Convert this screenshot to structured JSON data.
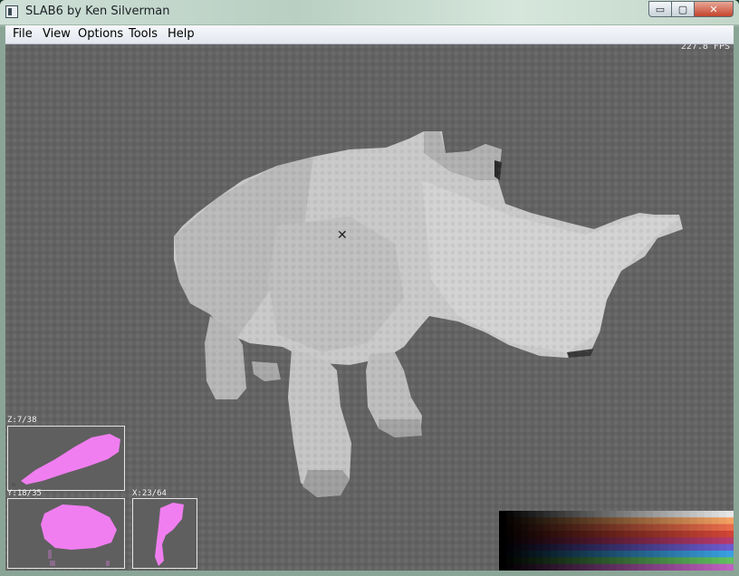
{
  "window": {
    "title": "SLAB6 by Ken Silverman",
    "buttons": {
      "minimize": "▭",
      "maximize": "▢",
      "close": "✕"
    }
  },
  "menu": {
    "items": [
      {
        "label": "File"
      },
      {
        "label": "View"
      },
      {
        "label": "Options"
      },
      {
        "label": "Tools"
      },
      {
        "label": "Help"
      }
    ]
  },
  "viewport": {
    "fps": "227.8 FPS",
    "background": "#636363",
    "cursor_glyph": "✕"
  },
  "slices": {
    "z": {
      "label": "Z:7/38"
    },
    "y": {
      "label": "Y:18/35"
    },
    "x": {
      "label": "X:23/64"
    },
    "fill_color": "#f07ef0"
  },
  "palette": {
    "columns": [
      "#000000",
      "#1c1c1c",
      "#3a3a3a",
      "#555555",
      "#777777",
      "#999999",
      "#bbbbbb",
      "#dddddd",
      "#ffffff"
    ],
    "rows": [
      "#e6e6e6",
      "#f3a060",
      "#e86a4a",
      "#cf4536",
      "#b83a6c",
      "#6b5ccf",
      "#3aa0e0",
      "#60c060",
      "#c060c0"
    ]
  }
}
